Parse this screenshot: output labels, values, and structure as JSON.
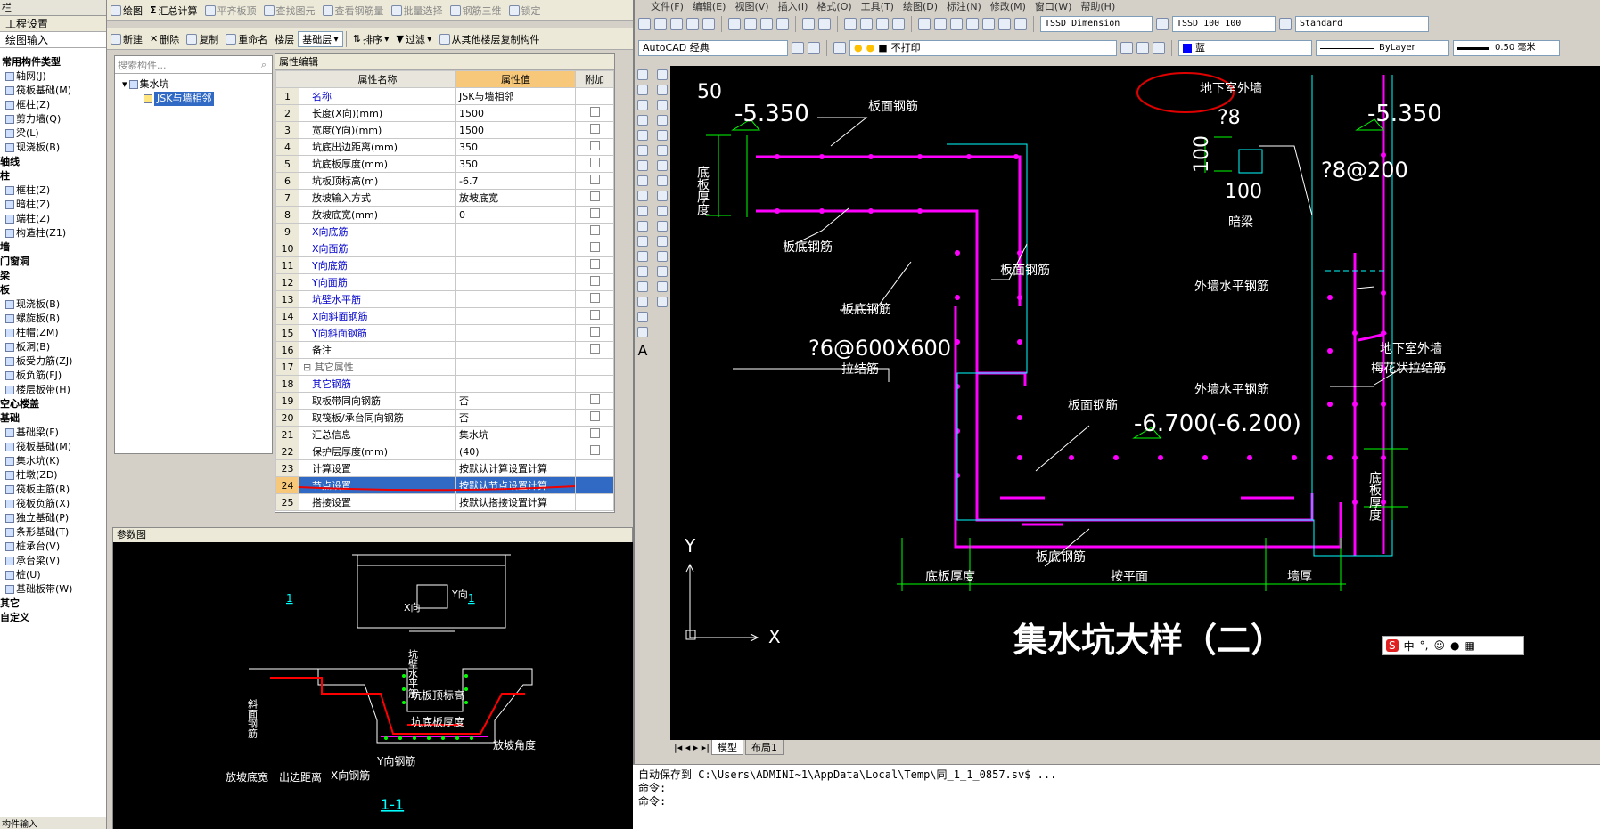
{
  "left_panel": {
    "header": "栏",
    "tab_project": "工程设置",
    "tab_draw": "绘图输入",
    "section_common": "常用构件类型",
    "items": [
      {
        "label": "轴网(J)",
        "indent": 1
      },
      {
        "label": "筏板基础(M)",
        "indent": 1
      },
      {
        "label": "框柱(Z)",
        "indent": 1
      },
      {
        "label": "剪力墙(Q)",
        "indent": 1
      },
      {
        "label": "梁(L)",
        "indent": 1
      },
      {
        "label": "现浇板(B)",
        "indent": 1
      },
      {
        "label": "轴线",
        "indent": 0
      },
      {
        "label": "柱",
        "indent": 0
      },
      {
        "label": "框柱(Z)",
        "indent": 1
      },
      {
        "label": "暗柱(Z)",
        "indent": 1
      },
      {
        "label": "端柱(Z)",
        "indent": 1
      },
      {
        "label": "构造柱(Z1)",
        "indent": 1
      },
      {
        "label": "墙",
        "indent": 0
      },
      {
        "label": "门窗洞",
        "indent": 0
      },
      {
        "label": "梁",
        "indent": 0
      },
      {
        "label": "板",
        "indent": 0
      },
      {
        "label": "现浇板(B)",
        "indent": 1
      },
      {
        "label": "螺旋板(B)",
        "indent": 1
      },
      {
        "label": "柱帽(ZM)",
        "indent": 1
      },
      {
        "label": "板洞(B)",
        "indent": 1
      },
      {
        "label": "板受力筋(ZJ)",
        "indent": 1
      },
      {
        "label": "板负筋(FJ)",
        "indent": 1
      },
      {
        "label": "楼层板带(H)",
        "indent": 1
      },
      {
        "label": "空心楼盖",
        "indent": 0
      },
      {
        "label": "基础",
        "indent": 0
      },
      {
        "label": "基础梁(F)",
        "indent": 1
      },
      {
        "label": "筏板基础(M)",
        "indent": 1
      },
      {
        "label": "集水坑(K)",
        "indent": 1
      },
      {
        "label": "柱墩(ZD)",
        "indent": 1
      },
      {
        "label": "筏板主筋(R)",
        "indent": 1
      },
      {
        "label": "筏板负筋(X)",
        "indent": 1
      },
      {
        "label": "独立基础(P)",
        "indent": 1
      },
      {
        "label": "条形基础(T)",
        "indent": 1
      },
      {
        "label": "桩承台(V)",
        "indent": 1
      },
      {
        "label": "承台梁(V)",
        "indent": 1
      },
      {
        "label": "桩(U)",
        "indent": 1
      },
      {
        "label": "基础板带(W)",
        "indent": 1
      },
      {
        "label": "其它",
        "indent": 0
      },
      {
        "label": "自定义",
        "indent": 0
      }
    ],
    "footer": "构件输入"
  },
  "top_toolbar": {
    "draw": "绘图",
    "summary": "汇总计算",
    "flat_top": "平齐板顶",
    "find": "查找图元",
    "view_rebar": "查看钢筋量",
    "batch_select": "批量选择",
    "rebar_3d": "钢筋三维",
    "lock": "锁定"
  },
  "second_toolbar": {
    "new": "新建",
    "delete": "删除",
    "copy": "复制",
    "rename": "重命名",
    "floor_label": "楼层",
    "floor_value": "基础层",
    "sort": "排序",
    "filter": "过滤",
    "copy_from_floor": "从其他楼层复制构件"
  },
  "component_list": {
    "search_placeholder": "搜索构件...",
    "root": "集水坑",
    "child": "JSK与墙相邻"
  },
  "property_panel": {
    "tab": "属性编辑",
    "col_no": "",
    "col_name": "属性名称",
    "col_value": "属性值",
    "col_extra": "附加",
    "rows": [
      {
        "no": "1",
        "name": "名称",
        "value": "JSK与墙相邻",
        "blue": true,
        "cb": false
      },
      {
        "no": "2",
        "name": "长度(X向)(mm)",
        "value": "1500",
        "blue": false,
        "cb": true
      },
      {
        "no": "3",
        "name": "宽度(Y向)(mm)",
        "value": "1500",
        "blue": false,
        "cb": true
      },
      {
        "no": "4",
        "name": "坑底出边距离(mm)",
        "value": "350",
        "blue": false,
        "cb": true
      },
      {
        "no": "5",
        "name": "坑底板厚度(mm)",
        "value": "350",
        "blue": false,
        "cb": true
      },
      {
        "no": "6",
        "name": "坑板顶标高(m)",
        "value": "-6.7",
        "blue": false,
        "cb": true
      },
      {
        "no": "7",
        "name": "放坡输入方式",
        "value": "放坡底宽",
        "blue": false,
        "cb": true
      },
      {
        "no": "8",
        "name": "放坡底宽(mm)",
        "value": "0",
        "blue": false,
        "cb": true
      },
      {
        "no": "9",
        "name": "X向底筋",
        "value": "",
        "blue": true,
        "cb": true
      },
      {
        "no": "10",
        "name": "X向面筋",
        "value": "",
        "blue": true,
        "cb": true
      },
      {
        "no": "11",
        "name": "Y向底筋",
        "value": "",
        "blue": true,
        "cb": true
      },
      {
        "no": "12",
        "name": "Y向面筋",
        "value": "",
        "blue": true,
        "cb": true
      },
      {
        "no": "13",
        "name": "坑壁水平筋",
        "value": "",
        "blue": true,
        "cb": true
      },
      {
        "no": "14",
        "name": "X向斜面钢筋",
        "value": "",
        "blue": true,
        "cb": true
      },
      {
        "no": "15",
        "name": "Y向斜面钢筋",
        "value": "",
        "blue": true,
        "cb": true
      },
      {
        "no": "16",
        "name": "备注",
        "value": "",
        "blue": false,
        "cb": true
      },
      {
        "no": "17",
        "name": "⊟ 其它属性",
        "value": "",
        "blue": false,
        "cb": false,
        "group": true
      },
      {
        "no": "18",
        "name": "其它钢筋",
        "value": "",
        "blue": true,
        "cb": false
      },
      {
        "no": "19",
        "name": "取板带同向钢筋",
        "value": "否",
        "blue": false,
        "cb": true
      },
      {
        "no": "20",
        "name": "取筏板/承台同向钢筋",
        "value": "否",
        "blue": false,
        "cb": true
      },
      {
        "no": "21",
        "name": "汇总信息",
        "value": "集水坑",
        "blue": false,
        "cb": true
      },
      {
        "no": "22",
        "name": "保护层厚度(mm)",
        "value": "(40)",
        "blue": false,
        "cb": true
      },
      {
        "no": "23",
        "name": "计算设置",
        "value": "按默认计算设置计算",
        "blue": false,
        "cb": false
      },
      {
        "no": "24",
        "name": "节点设置",
        "value": "按默认节点设置计算",
        "blue": false,
        "cb": false,
        "selected": true
      },
      {
        "no": "25",
        "name": "搭接设置",
        "value": "按默认搭接设置计算",
        "blue": false,
        "cb": false
      }
    ]
  },
  "param_diagram": {
    "title": "参数图",
    "labels": {
      "x_dir": "X向",
      "y_dir": "Y向",
      "wall_h": "坑壁水平筋",
      "top_elev": "坑板顶标高",
      "bottom_thk": "坑底板厚度",
      "slope_angle": "放坡角度",
      "slope_width": "放坡底宽",
      "edge_dist": "出边距离",
      "x_rebar": "X向钢筋",
      "y_rebar": "Y向钢筋",
      "slope_rebar": "斜面钢筋",
      "section": "1-1",
      "mark1": "1",
      "mark2": "1"
    }
  },
  "cad": {
    "menu": [
      "文件(F)",
      "编辑(E)",
      "视图(V)",
      "插入(I)",
      "格式(O)",
      "工具(T)",
      "绘图(D)",
      "标注(N)",
      "修改(M)",
      "窗口(W)",
      "帮助(H)"
    ],
    "workspace": "AutoCAD 经典",
    "layer": "不打印",
    "color": "蓝",
    "linetype": "ByLayer",
    "lineweight": "0.50 毫米",
    "dim_style": "TSSD_Dimension",
    "text_style": "TSSD_100_100",
    "table_style": "Standard",
    "tabs": [
      "模型",
      "布局1"
    ],
    "drawing": {
      "elev_left": "-5.350",
      "elev_right": "-5.350",
      "elev_bottom": "-6.700(-6.200)",
      "top_left_50": "50",
      "dim_100a": "100",
      "dim_100b": "100",
      "rebar_1": "?8",
      "rebar_2": "?8@200",
      "rebar_3": "?6@600X600",
      "tie": "拉结筋",
      "label_bmgj1": "板面钢筋",
      "label_bdgj1": "板底钢筋",
      "label_bmgj2": "板面钢筋",
      "label_bdgj2": "板底钢筋",
      "label_bmgj3": "板面钢筋",
      "label_bdgj3": "板底钢筋",
      "dbhd": "底板厚度",
      "dbhd2": "底板厚度",
      "dbhd3": "底板厚度",
      "anliang": "暗梁",
      "waiqiang": "地下室外墙",
      "waiqiang2": "地下室外墙",
      "meihua": "梅花状拉结筋",
      "wqspj1": "外墙水平钢筋",
      "wqspj2": "外墙水平钢筋",
      "anpingmian": "按平面",
      "qianghou": "墙厚",
      "title": "集水坑大样（二）",
      "axis_x": "X",
      "axis_y": "Y"
    },
    "command_lines": [
      "自动保存到 C:\\Users\\ADMINI~1\\AppData\\Local\\Temp\\同_1_1_0857.sv$ ...",
      "命令:",
      "命令:"
    ],
    "ime": "中"
  },
  "colors": {
    "accent": "#316ac5",
    "magenta": "#ff00ff",
    "cyan": "#00ffff",
    "green": "#00ff00",
    "red": "#ff0000"
  }
}
